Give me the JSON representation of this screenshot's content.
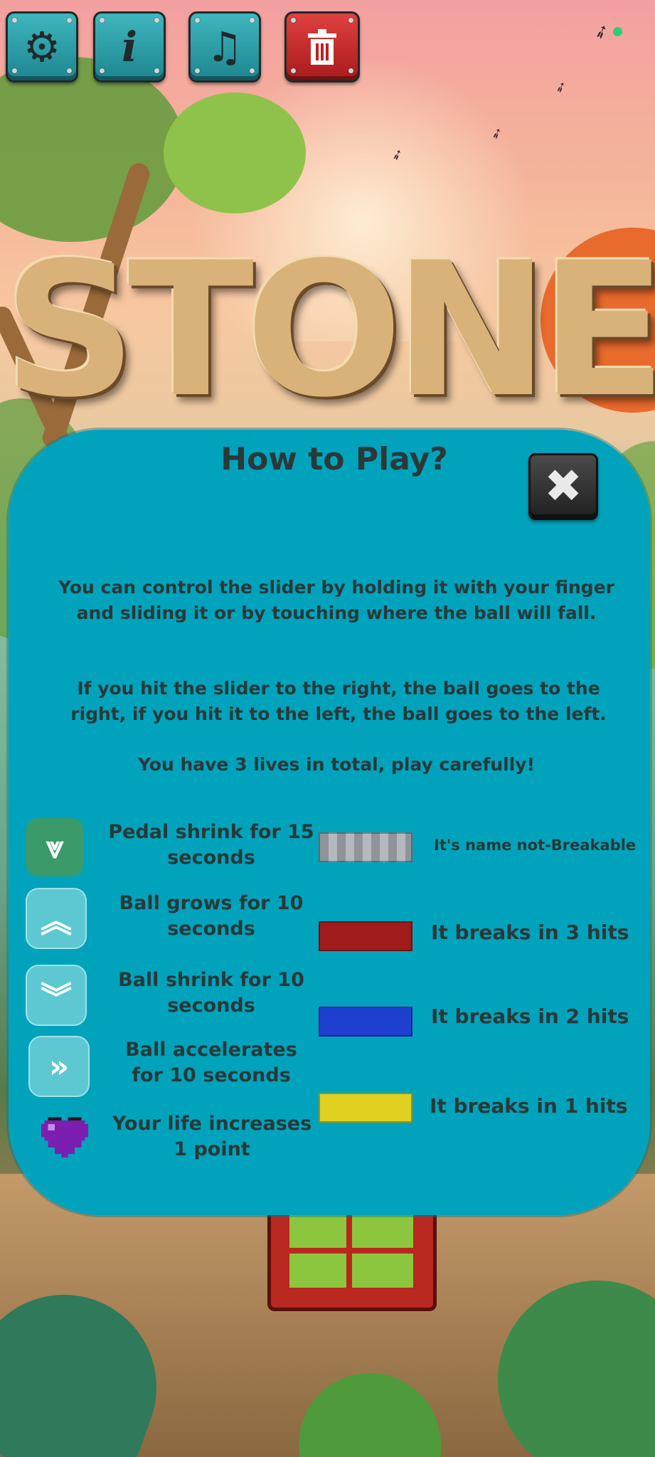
{
  "top_bar": {
    "buttons": [
      {
        "name": "settings",
        "icon": "gear-icon",
        "glyph": "⚙"
      },
      {
        "name": "info",
        "icon": "info-icon",
        "glyph": "i"
      },
      {
        "name": "music",
        "icon": "music-note-icon",
        "glyph": "♫"
      },
      {
        "name": "delete",
        "icon": "trash-icon",
        "glyph": "🗑"
      }
    ]
  },
  "logo": {
    "text": "STONE"
  },
  "panel": {
    "title": "How to Play?",
    "close_glyph": "✖",
    "paragraphs": [
      "You can control the slider by holding it with your finger and sliding it or by touching where the ball will fall.",
      "If you hit the slider to the right, the ball goes to the right, if you hit it to the left, the ball goes to the left.",
      "You have 3 lives in total, play carefully!"
    ],
    "powerups": [
      {
        "icon": "double-chevron-down-icon",
        "glyph": "⩔",
        "text": "Pedal shrink for 15 seconds",
        "color": "#3a9a6a"
      },
      {
        "icon": "double-chevron-up-icon",
        "glyph": "︽",
        "text": "Ball grows for 10 seconds",
        "color": "#5ec8d2"
      },
      {
        "icon": "double-chevron-down-icon",
        "glyph": "︾",
        "text": "Ball shrink for 10 seconds",
        "color": "#5ec8d2"
      },
      {
        "icon": "double-chevron-right-icon",
        "glyph": "»",
        "text": "Ball accelerates for 10 seconds",
        "color": "#5ec8d2"
      },
      {
        "icon": "heart-icon",
        "glyph": "",
        "text": "Your life increases 1 point",
        "color": "#7a1fb0"
      }
    ],
    "bricks": [
      {
        "color": "#9aa0a6",
        "text": "It's name not-Breakable"
      },
      {
        "color": "#a01c1c",
        "text": "It breaks in 3 hits"
      },
      {
        "color": "#1f3fd0",
        "text": "It breaks in 2 hits"
      },
      {
        "color": "#e0d020",
        "text": "It breaks in 1 hits"
      }
    ]
  }
}
